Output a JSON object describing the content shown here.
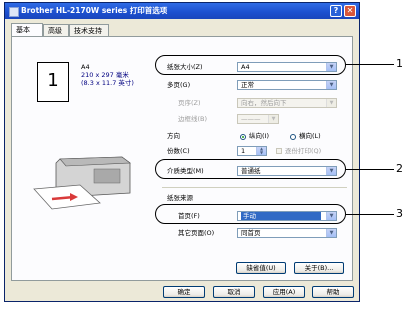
{
  "window": {
    "title": "Brother HL-2170W series 打印首选项"
  },
  "tabs": [
    {
      "label": "基本"
    },
    {
      "label": "高级"
    },
    {
      "label": "技术支持"
    }
  ],
  "preview": {
    "page_number": "1",
    "paper_name": "A4",
    "dims_mm": "210 x 297 毫米",
    "dims_in": "(8.3 x 11.7 英寸)"
  },
  "settings": {
    "paper_size": {
      "label": "纸张大小(Z)",
      "value": "A4"
    },
    "multiple_page": {
      "label": "多页(G)",
      "value": "正常"
    },
    "page_order": {
      "label": "页序(Z)",
      "value": "向右，然后向下"
    },
    "border_line": {
      "label": "边框线(B)",
      "value": "———"
    },
    "orientation": {
      "label": "方向",
      "portrait": "纵向(I)",
      "landscape": "横向(L)"
    },
    "copies": {
      "label": "份数(C)",
      "value": "1",
      "collate": "逐份打印(Q)"
    },
    "media_type": {
      "label": "介质类型(M)",
      "value": "普通纸"
    },
    "paper_source": {
      "label": "纸张来源",
      "first_page": {
        "label": "首页(F)",
        "value": "手动"
      },
      "other_pages": {
        "label": "其它页面(O)",
        "value": "同首页"
      }
    }
  },
  "panel_buttons": {
    "default": "缺省值(U)",
    "about": "关于(B)..."
  },
  "dialog_buttons": {
    "ok": "确定",
    "cancel": "取消",
    "apply": "应用(A)",
    "help": "帮助"
  },
  "callouts": [
    "1",
    "2",
    "3"
  ]
}
